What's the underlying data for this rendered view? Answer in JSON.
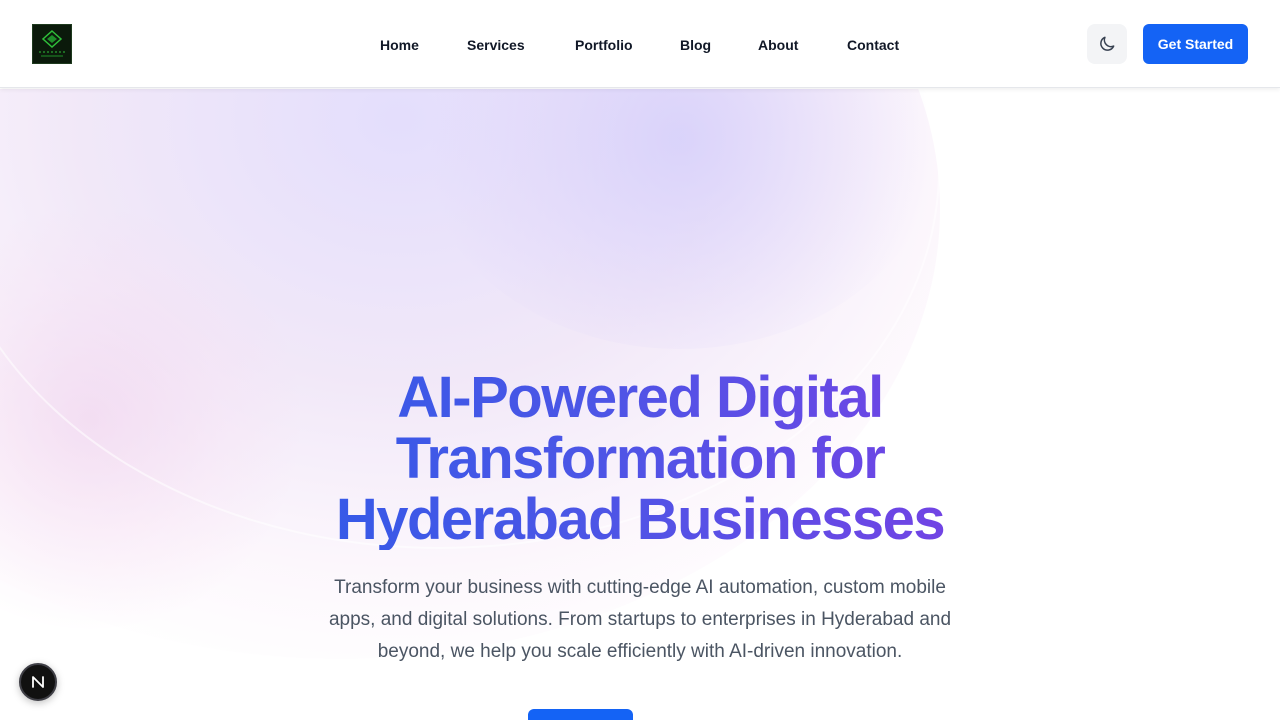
{
  "header": {
    "logo_alt": "Company logo",
    "nav": [
      {
        "label": "Home"
      },
      {
        "label": "Services"
      },
      {
        "label": "Portfolio"
      },
      {
        "label": "Blog"
      },
      {
        "label": "About"
      },
      {
        "label": "Contact"
      }
    ],
    "theme_toggle_icon": "moon-icon",
    "cta_label": "Get Started"
  },
  "hero": {
    "title_line1": "AI-Powered Digital",
    "title_line2": "Transformation for",
    "title_line3": "Hyderabad Businesses",
    "subtitle": "Transform your business with cutting-edge AI automation, custom mobile apps, and digital solutions. From startups to enterprises in Hyderabad and beyond, we help you scale efficiently with AI-driven innovation.",
    "primary_button_label": ""
  },
  "dev_badge": {
    "letter": "N"
  },
  "colors": {
    "accent": "#1463f5",
    "gradient_start": "#2f5be8",
    "gradient_end": "#7b3fe4",
    "text_muted": "#4b5563"
  }
}
